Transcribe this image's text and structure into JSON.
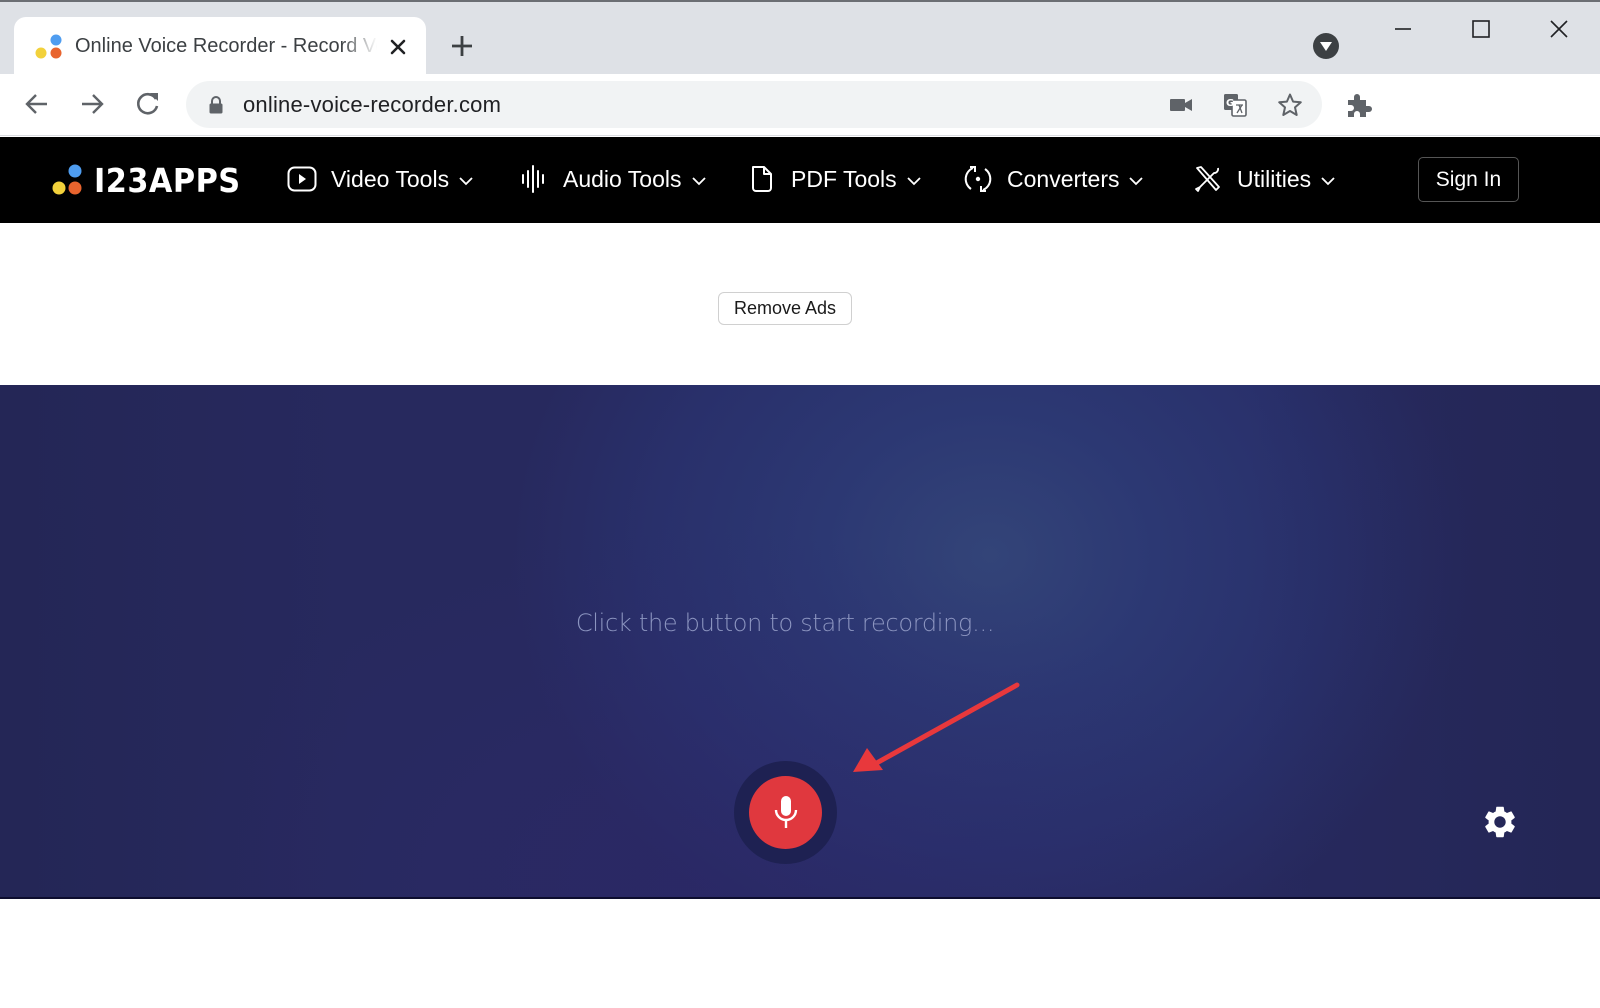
{
  "browser": {
    "tab": {
      "title": "Online Voice Recorder - Record Voice",
      "favicon": "123apps-dots-icon"
    },
    "new_tab_icon": "plus-icon",
    "tab_search_icon": "tab-search-dropdown-icon",
    "window_controls": [
      "minimize-icon",
      "maximize-icon",
      "close-icon"
    ],
    "nav": [
      "back-arrow-icon",
      "forward-arrow-icon",
      "reload-icon"
    ],
    "address_bar": {
      "url": "online-voice-recorder.com",
      "security_icon": "lock-icon",
      "right_icons": [
        "camera-icon",
        "translate-icon",
        "bookmark-star-icon"
      ]
    },
    "extensions_icon": "puzzle-piece-icon"
  },
  "site_header": {
    "logo_text": "I23APPS",
    "logo_colors": {
      "blue": "#4f9df0",
      "yellow": "#f2d13b",
      "orange": "#e8642e"
    },
    "menu": [
      {
        "label": "Video Tools",
        "icon": "video-play-icon"
      },
      {
        "label": "Audio Tools",
        "icon": "audio-waveform-icon"
      },
      {
        "label": "PDF Tools",
        "icon": "document-icon"
      },
      {
        "label": "Converters",
        "icon": "convert-cycle-icon"
      },
      {
        "label": "Utilities",
        "icon": "tools-icon"
      }
    ],
    "sign_in_label": "Sign In"
  },
  "ad_area": {
    "remove_ads_label": "Remove Ads"
  },
  "recorder": {
    "prompt": "Click the button to start recording...",
    "record_button_icon": "microphone-icon",
    "settings_icon": "gear-icon",
    "accent_color": "#e0383e",
    "annotation": "red-arrow-pointing-to-record-button"
  }
}
